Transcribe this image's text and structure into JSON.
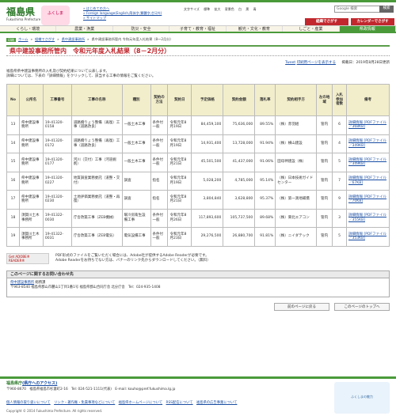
{
  "header": {
    "logo_jp": "福島県",
    "logo_en": "Fukushima Prefecture",
    "mascot": "ふくしま",
    "links": [
      "» はじめての方へ",
      "» Foreign language(English,简体字,繁體字,한국어)",
      "» サイトマップ"
    ],
    "util": [
      "文字サイズ",
      "標準",
      "拡大",
      "背景色",
      "白",
      "黒",
      "青"
    ],
    "search_placeholder": "Google 検索",
    "search_button": "検索",
    "btn_org": "組織でさがす",
    "btn_cal": "カレンダーでさがす"
  },
  "gnav": [
    "くらし・環境",
    "農業・漁業",
    "防災・安全",
    "子育て・教育・福祉",
    "観光・文化・教育",
    "しごと・産業",
    "県政情報"
  ],
  "breadcrumb": {
    "print": "印刷",
    "items": [
      "ホーム",
      "組織でさがす",
      "県中建設事務所",
      "県中建設事務所管内 令和元年度入札結果（8～2月分）"
    ]
  },
  "page_title": "県中建設事務所管内　令和元年度入札結果（8－2月分）",
  "meta": {
    "tweet": "Tweet",
    "print": "印刷用ページを表示する",
    "date": "掲載日：2019年8月28日更新"
  },
  "intro": [
    "福島県県中建設事務所の入札及び契約結果について公表します。",
    "詳細については、下表の「詳細情報」をクリックして、該当する工事の情報をご覧ください。"
  ],
  "table": {
    "headers": [
      "No",
      "公所名",
      "工事番号",
      "工事の名称",
      "種別",
      "契約の方法",
      "契約日",
      "予定価格",
      "契約金額",
      "落札率",
      "契約相手方",
      "左の地域",
      "入札参加者数",
      "備考"
    ],
    "rows": [
      [
        "13",
        "県中建設事務所",
        "19-41320-0158",
        "道路橋りょう整備（再復）工事（道路改良）",
        "一般土木工事",
        "条件付一般",
        "令和元年8月19日",
        "84,459,100",
        "75,636,000",
        "89.55%",
        "（株）赤羽組",
        "管内",
        "6",
        "詳細情報 [PDFファイル／368KB]"
      ],
      [
        "14",
        "県中建設事務所",
        "19-41320-0172",
        "道路橋りょう整備（再復）工事（道路改良）",
        "一般土木工事",
        "条件付一般",
        "令和元年8月19日",
        "14,931,400",
        "13,728,000",
        "91.94%",
        "（株）横山建設",
        "管内",
        "4",
        "詳細情報 [PDFファイル／349KB]"
      ],
      [
        "15",
        "県中建設事務所",
        "19-41320-0177",
        "河川（交付）工事（河道掘削）",
        "一般土木工事",
        "条件付一般",
        "令和元年8月21日",
        "45,501,500",
        "41,437,000",
        "91.06%",
        "田母神建設（株）",
        "管内",
        "5",
        "詳細情報 [PDFファイル／349KB]"
      ],
      [
        "16",
        "県中建設事務所",
        "19-41320-0227",
        "地質調査業務委託（道整・交付）",
        "調査",
        "指名",
        "令和元年8月19日",
        "5,028,200",
        "4,785,000",
        "95.14%",
        "（株）日本技術ガイドセンター",
        "管内",
        "7",
        "詳細情報 [PDFファイル／67KB]"
      ],
      [
        "17",
        "県中建設事務所",
        "19-41320-0230",
        "土地評価業務委託（道整・再復）",
        "調査",
        "指名",
        "令和元年8月21日",
        "3,804,840",
        "3,628,800",
        "95.37%",
        "（株）第一測地補償",
        "管内",
        "9",
        "詳細情報 [PDFファイル／70KB]"
      ],
      [
        "18",
        "須賀川土木事務所",
        "19-41322-0030",
        "庁舎改築工事（ZEB機械）",
        "暖冷房衛生設備工事",
        "条件付一般",
        "令和元年8月26日",
        "117,893,600",
        "105,737,500",
        "89.68%",
        "（株）東北エアコン",
        "管内",
        "3",
        "詳細情報 [PDFファイル／355KB]"
      ],
      [
        "19",
        "須賀川土木事務所",
        "19-41322-0031",
        "庁舎改築工事（ZEB電気）",
        "電気設備工事",
        "条件付一般",
        "令和元年8月23日",
        "29,276,500",
        "26,880,700",
        "91.81%",
        "（株）ニイダテック",
        "管内",
        "5",
        "詳細情報 [PDFファイル／353KB]"
      ]
    ]
  },
  "adobe": {
    "logo": "Get ADOBE® READER®",
    "text": [
      "PDF形式のファイルをご覧いただく場合には、Adobe社が提供するAdobe Readerが必要です。",
      "Adobe Readerをお持ちでない方は、バナーのリンク先からダウンロードしてください。（無料）"
    ]
  },
  "inquiry": {
    "head": "このページに関するお問い合わせ先",
    "org": "県中建設事務所",
    "section": "総務課",
    "address": "〒963-8540 福島県郡山市麓山1丁目1番1号 福島県郡山合同庁舎 北分庁舎",
    "tel": "Tel：024-935-1408"
  },
  "bottomnav": [
    "前のページに戻る",
    "このページのトップへ"
  ],
  "footer": {
    "name": "福島県庁",
    "access": "(県庁へのアクセス)",
    "addr": "〒960-8670　福島県福島市杉妻町2-16　Tel: 024-521-1111(代表)　E-mail: kouho@pref.fukushima.lg.jp",
    "links": [
      "個人情報の取り扱いについて",
      "リンク・著作権・免責事項などについて",
      "福島県ホームページについて",
      "RSS配信について",
      "福島県の広告事業について"
    ],
    "copyright": "Copyright © 2014 Fukushima Prefecture. All rights reserved.",
    "banner": "ふくしまの魅力"
  }
}
